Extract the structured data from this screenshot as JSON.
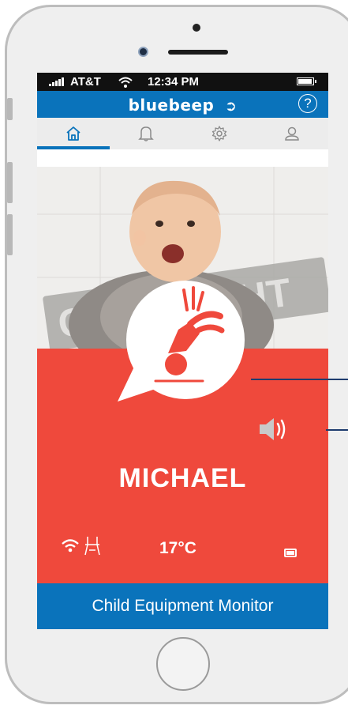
{
  "status_bar": {
    "carrier": "AT&T",
    "time": "12:34 PM"
  },
  "app_bar": {
    "brand": "bluebeep",
    "help_label": "?"
  },
  "tabs": [
    {
      "name": "home-icon",
      "active": true
    },
    {
      "name": "bell-icon",
      "active": false
    },
    {
      "name": "gear-icon",
      "active": false
    },
    {
      "name": "user-icon",
      "active": false
    }
  ],
  "alert": {
    "icon": "child-fall-icon",
    "child_name": "MICHAEL",
    "temperature": "17°C",
    "sound_icon": "speaker-icon",
    "watermark": "COPYRIGHT"
  },
  "footer": {
    "title": "Child Equipment Monitor"
  },
  "colors": {
    "brand_blue": "#0a73bb",
    "alert_red": "#ef493c"
  }
}
